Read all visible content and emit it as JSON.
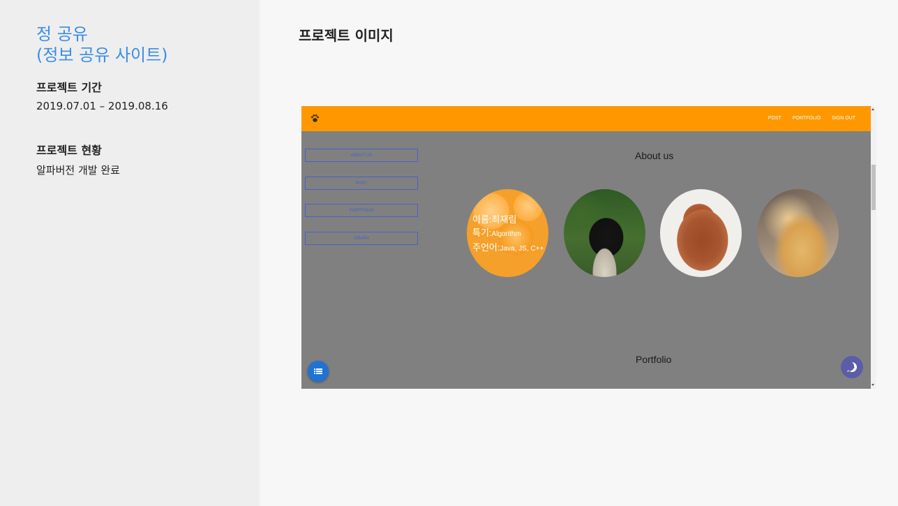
{
  "sidebar": {
    "title": "정 공유\n(정보 공유 사이트)",
    "period_label": "프로젝트 기간",
    "period_value": "2019.07.01 – 2019.08.16",
    "status_label": "프로젝트 현황",
    "status_value": "알파버전 개발 완료"
  },
  "main": {
    "heading": "프로젝트 이미지"
  },
  "screenshot": {
    "nav_links": [
      "POST",
      "PORTFOLIO",
      "SIGN OUT"
    ],
    "side_buttons": [
      "ABOUT US",
      "POST",
      "PORTFOLIO",
      "GRAPH"
    ],
    "about_title": "About us",
    "portfolio_title": "Portfolio",
    "profile_lines": [
      {
        "label": "이름:",
        "value": "최재림"
      },
      {
        "label": "특기:",
        "value": "Algorithm"
      },
      {
        "label": "주언어:",
        "value": "Java, JS, C++"
      }
    ],
    "colors": {
      "navbar": "#ff9800",
      "overlay": "#808080",
      "accent": "#3a8ee6"
    }
  }
}
